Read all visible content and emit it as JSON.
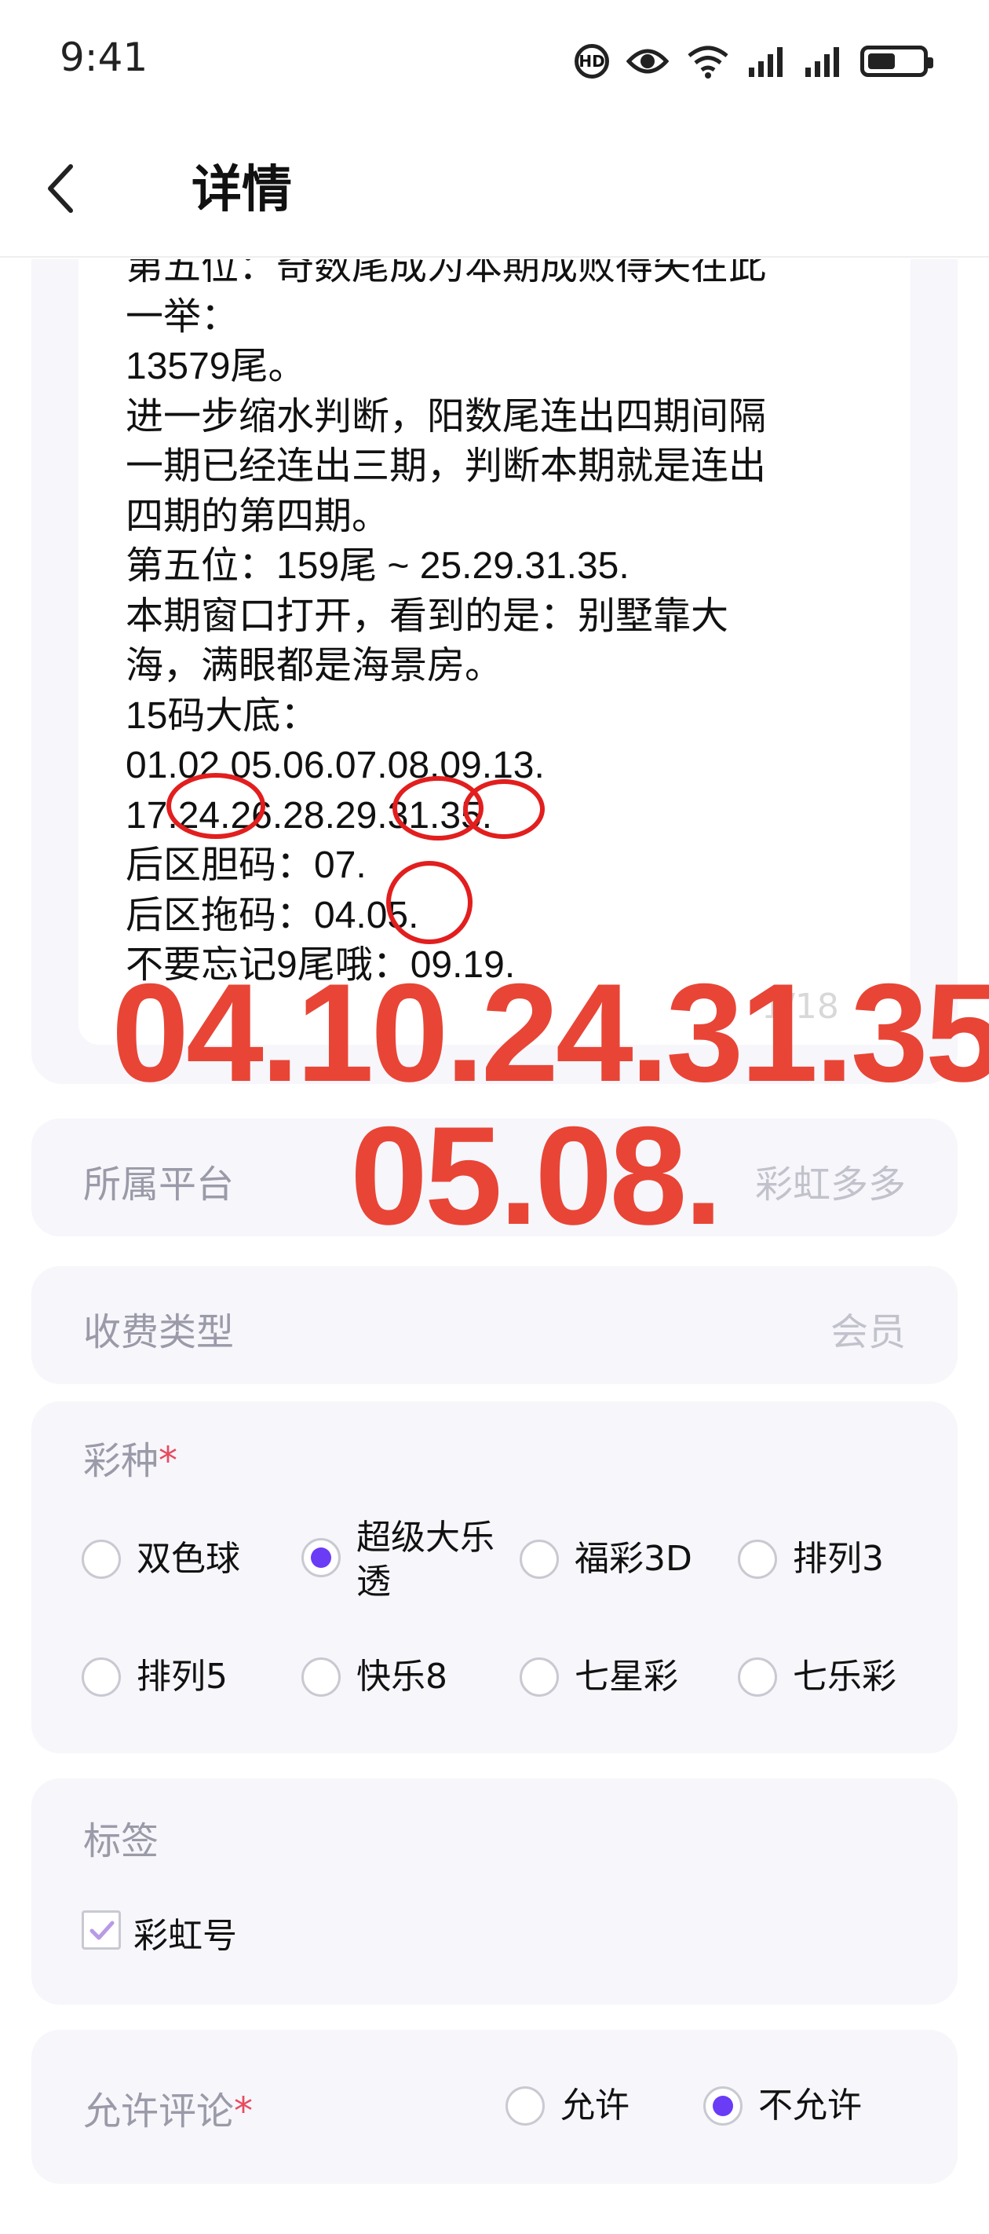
{
  "status_bar": {
    "time": "9:41",
    "hd_label": "HD"
  },
  "header": {
    "title": "详情"
  },
  "post": {
    "lines": [
      "第五位：奇数尾成为本期成败得失在此",
      "一举：",
      "13579尾。",
      "进一步缩水判断，阳数尾连出四期间隔",
      "一期已经连出三期，判断本期就是连出",
      "四期的第四期。",
      "第五位：159尾 ~ 25.29.31.35.",
      "本期窗口打开，看到的是：别墅靠大",
      "海，满眼都是海景房。",
      "15码大底：",
      "01.02.05.06.07.08.09.13.",
      "17.24.26.28.29.31.35.",
      "后区胆码：07.",
      "后区拖码：04.05.",
      "不要忘记9尾哦：09.19."
    ],
    "page_indicator": "1/18",
    "overlay_line1": "04.10.24.31.35.",
    "overlay_line2": "05.08."
  },
  "platform": {
    "label": "所属平台",
    "value": "彩虹多多"
  },
  "fee": {
    "label": "收费类型",
    "value": "会员"
  },
  "lottery": {
    "label": "彩种",
    "required_mark": "*",
    "options": [
      "双色球",
      "超级大乐透",
      "福彩3D",
      "排列3",
      "排列5",
      "快乐8",
      "七星彩",
      "七乐彩"
    ],
    "option2_line1": "超级大乐",
    "option2_line2": "透",
    "selected": "超级大乐透"
  },
  "tags": {
    "label": "标签",
    "items": [
      "彩虹号"
    ]
  },
  "comments": {
    "label": "允许评论",
    "required_mark": "*",
    "options": [
      "允许",
      "不允许"
    ],
    "selected": "不允许"
  },
  "colors": {
    "accent": "#6a3cf5",
    "overlay_red": "#e84536",
    "required": "#e84a5f",
    "card_bg": "#f6f6fb"
  }
}
